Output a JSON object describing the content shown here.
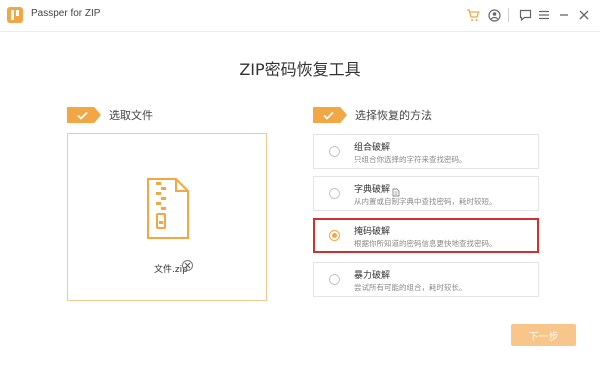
{
  "app": {
    "title": "Passper for ZIP"
  },
  "titlebar_icons": [
    "cart-icon",
    "account-icon",
    "feedback-icon",
    "menu-icon",
    "minimize-icon",
    "close-icon"
  ],
  "main_title": "ZIP密码恢复工具",
  "left_section": {
    "label": "选取文件",
    "file_name": "文件.zip"
  },
  "right_section": {
    "label": "选择恢复的方法",
    "methods": [
      {
        "title": "组合破解",
        "desc": "只组合你选择的字符来查找密码。",
        "selected": false
      },
      {
        "title": "字典破解",
        "desc": "从内置或自制字典中查找密码，耗时较短。",
        "selected": false
      },
      {
        "title": "掩码破解",
        "desc": "根据你所知道的密码信息更快地查找密码。",
        "selected": true
      },
      {
        "title": "暴力破解",
        "desc": "尝试所有可能的组合，耗时较长。",
        "selected": false
      }
    ]
  },
  "next_button": {
    "label": "下一步"
  },
  "colors": {
    "accent": "#f2a744",
    "selected_border": "#d32f2f",
    "next_button": "#f8c58a"
  }
}
